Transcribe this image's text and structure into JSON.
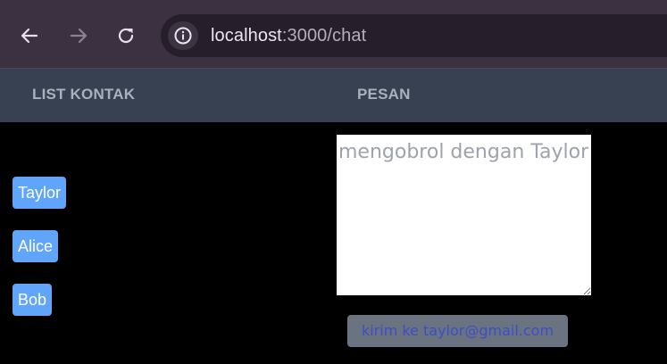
{
  "browser": {
    "url_host": "localhost",
    "url_rest": ":3000/chat",
    "icons": {
      "back": "arrow-left-icon",
      "forward": "arrow-right-icon",
      "reload": "reload-icon",
      "site_info": "site-info-icon"
    }
  },
  "header": {
    "contacts_title": "LIST KONTAK",
    "messages_title": "PESAN"
  },
  "contacts": [
    {
      "label": "Taylor"
    },
    {
      "label": "Alice"
    },
    {
      "label": "Bob"
    }
  ],
  "message": {
    "placeholder": "mengobrol dengan Taylor",
    "value": ""
  },
  "send_button": {
    "label": "kirim ke taylor@gmail.com"
  },
  "colors": {
    "chrome_bg": "#3b3141",
    "header_bg": "#374151",
    "contact_button": "#60a5fa",
    "send_button_bg": "#6b7280",
    "send_button_text": "#3b4ec9",
    "page_bg": "#000000"
  }
}
